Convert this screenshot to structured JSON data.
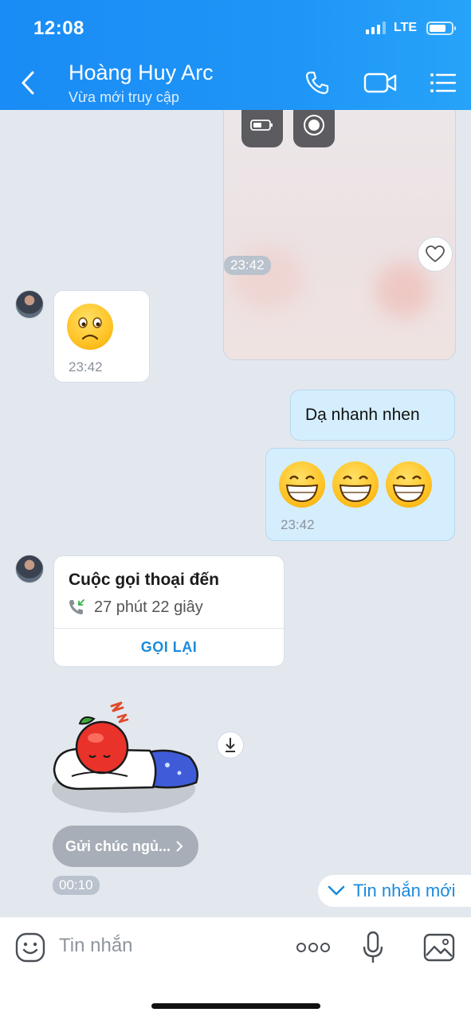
{
  "status_bar": {
    "time": "12:08",
    "network": "LTE"
  },
  "header": {
    "contact_name": "Hoàng Huy Arc",
    "contact_status": "Vừa mới truy cập"
  },
  "messages": {
    "photo": {
      "time": "23:42"
    },
    "sad_emoji": {
      "time": "23:42"
    },
    "outgoing_text": {
      "text": "Dạ nhanh nhen"
    },
    "outgoing_emoji": {
      "time": "23:42"
    },
    "call": {
      "title": "Cuộc gọi thoại đến",
      "duration": "27 phút 22 giây",
      "call_back_label": "GỌI LẠI"
    },
    "sticker": {
      "suggestion": "Gửi chúc ngủ...",
      "time": "00:10"
    }
  },
  "new_messages_label": "Tin nhắn mới",
  "input": {
    "placeholder": "Tin nhắn"
  },
  "colors": {
    "header": "#1a8cf5",
    "accent": "#1a8bdc",
    "outgoing_bubble": "#d5eefe"
  }
}
